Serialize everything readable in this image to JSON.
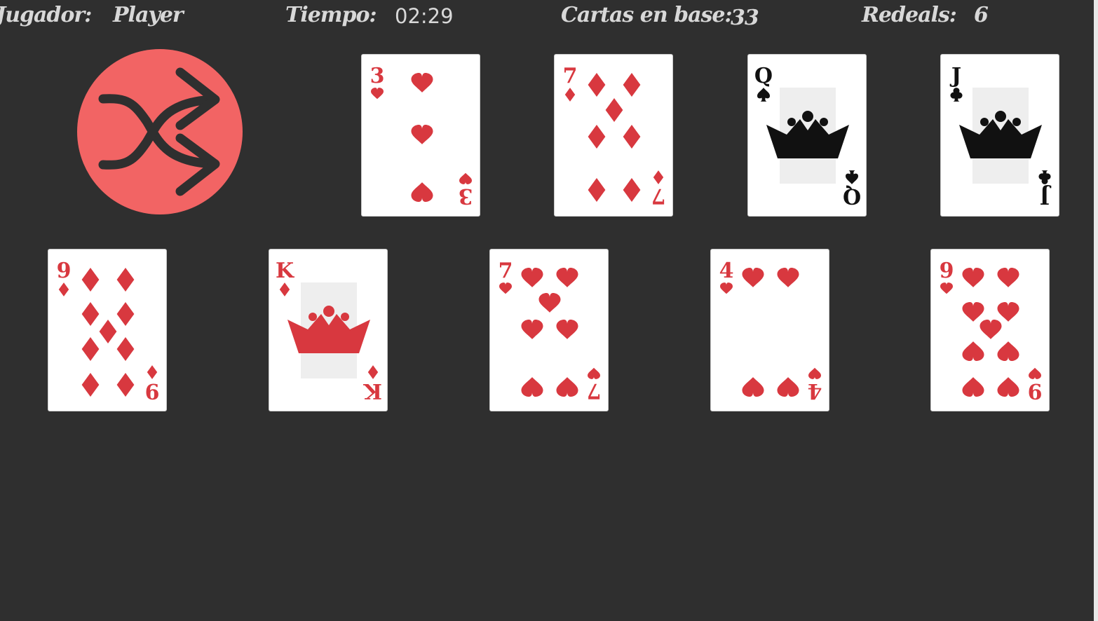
{
  "hud": {
    "player_label": "Jugador:",
    "player_value": "Player",
    "time_label": "Tiempo:",
    "time_value": "02:29",
    "base_label": "Cartas en base:",
    "base_value": "33",
    "redeals_label": "Redeals:",
    "redeals_value": "6"
  },
  "colors": {
    "background": "#2f2f2f",
    "red": "#d8383f",
    "black": "#111111",
    "shuffle": "#f26464"
  },
  "shuffle": {
    "icon": "shuffle-icon"
  },
  "top_row": [
    {
      "rank": "3",
      "suit": "hearts"
    },
    {
      "rank": "7",
      "suit": "diamonds"
    },
    {
      "rank": "Q",
      "suit": "spades"
    },
    {
      "rank": "J",
      "suit": "clubs"
    }
  ],
  "bottom_row": [
    {
      "rank": "9",
      "suit": "diamonds"
    },
    {
      "rank": "K",
      "suit": "diamonds"
    },
    {
      "rank": "7",
      "suit": "hearts"
    },
    {
      "rank": "4",
      "suit": "hearts"
    },
    {
      "rank": "9",
      "suit": "hearts"
    }
  ]
}
